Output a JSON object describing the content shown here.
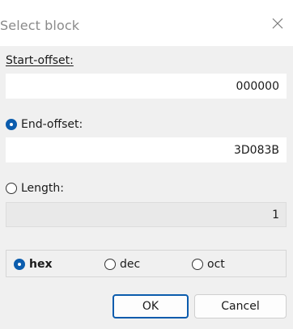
{
  "window": {
    "title": "Select block",
    "close_icon": "close-icon"
  },
  "start_offset": {
    "label": "Start-offset:",
    "value": "000000"
  },
  "end_offset": {
    "label": "End-offset:",
    "value": "3D083B",
    "selected": true
  },
  "length": {
    "label": "Length:",
    "value": "1",
    "selected": false,
    "disabled": true
  },
  "base": {
    "options": [
      {
        "label": "hex",
        "selected": true
      },
      {
        "label": "dec",
        "selected": false
      },
      {
        "label": "oct",
        "selected": false
      }
    ]
  },
  "buttons": {
    "ok": "OK",
    "cancel": "Cancel"
  },
  "colors": {
    "accent": "#0b5cad",
    "background": "#f0f0f0",
    "field": "#ffffff",
    "disabled_field": "#e9e9e9"
  }
}
